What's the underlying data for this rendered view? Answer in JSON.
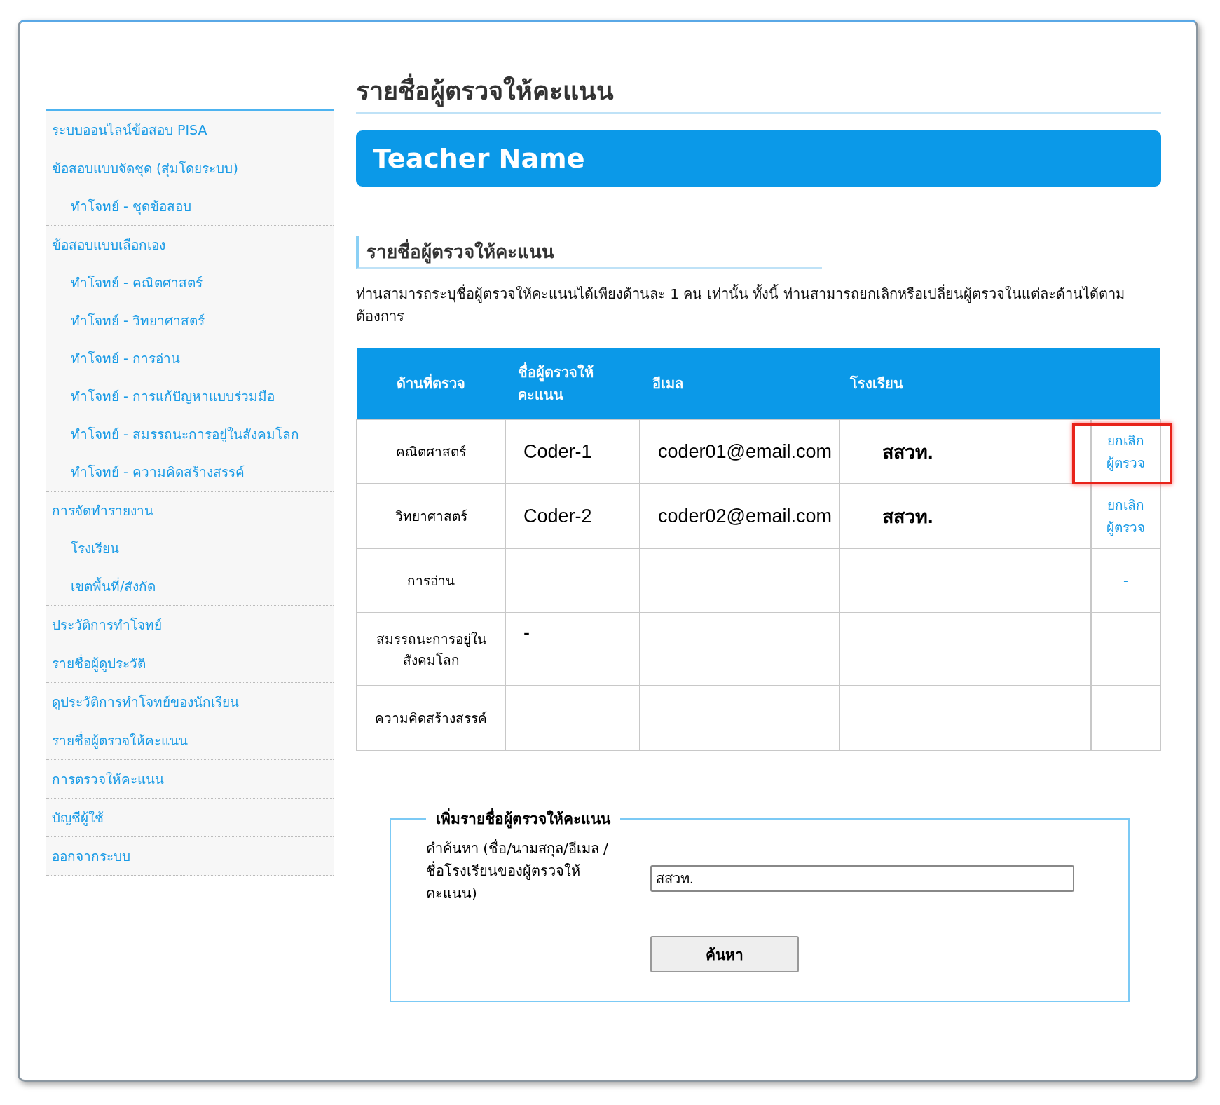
{
  "sidebar": {
    "items": [
      {
        "label": "ระบบออนไลน์ข้อสอบ PISA"
      },
      {
        "label": "ข้อสอบแบบจัดชุด (สุ่มโดยระบบ)",
        "children": [
          {
            "label": "ทำโจทย์ - ชุดข้อสอบ"
          }
        ]
      },
      {
        "label": "ข้อสอบแบบเลือกเอง",
        "children": [
          {
            "label": "ทำโจทย์ - คณิตศาสตร์"
          },
          {
            "label": "ทำโจทย์ - วิทยาศาสตร์"
          },
          {
            "label": "ทำโจทย์ - การอ่าน"
          },
          {
            "label": "ทำโจทย์ - การแก้ปัญหาแบบร่วมมือ"
          },
          {
            "label": "ทำโจทย์ - สมรรถนะการอยู่ในสังคมโลก"
          },
          {
            "label": "ทำโจทย์ - ความคิดสร้างสรรค์"
          }
        ]
      },
      {
        "label": "การจัดทำรายงาน",
        "children": [
          {
            "label": "โรงเรียน"
          },
          {
            "label": "เขตพื้นที่/สังกัด"
          }
        ]
      },
      {
        "label": "ประวัติการทำโจทย์"
      },
      {
        "label": "รายชื่อผู้ดูประวัติ"
      },
      {
        "label": "ดูประวัติการทำโจทย์ของนักเรียน"
      },
      {
        "label": "รายชื่อผู้ตรวจให้คะแนน"
      },
      {
        "label": "การตรวจให้คะแนน"
      },
      {
        "label": "บัญชีผู้ใช้"
      },
      {
        "label": "ออกจากระบบ"
      }
    ]
  },
  "page_title": "รายชื่อผู้ตรวจให้คะแนน",
  "banner": "Teacher Name",
  "section_title": "รายชื่อผู้ตรวจให้คะแนน",
  "description": "ท่านสามารถระบุชื่อผู้ตรวจให้คะแนนได้เพียงด้านละ 1 คน เท่านั้น ทั้งนี้ ท่านสามารถยกเลิกหรือเปลี่ยนผู้ตรวจในแต่ละด้านได้ตามต้องการ",
  "table": {
    "columns": [
      "ด้านที่ตรวจ",
      "ชื่อผู้ตรวจให้คะแนน",
      "อีเมล",
      "โรงเรียน"
    ],
    "rows": [
      {
        "domain": "คณิตศาสตร์",
        "coder": "Coder-1",
        "email": "coder01@email.com",
        "school": "สสวท.",
        "action": "ยกเลิกผู้ตรวจ",
        "highlighted": true
      },
      {
        "domain": "วิทยาศาสตร์",
        "coder": "Coder-2",
        "email": "coder02@email.com",
        "school": "สสวท.",
        "action": "ยกเลิกผู้ตรวจ",
        "highlighted": false
      },
      {
        "domain": "การอ่าน",
        "action": "-",
        "highlighted": false
      },
      {
        "domain": "สมรรถนะการอยู่ในสังคมโลก",
        "coder": "-",
        "highlighted": false
      },
      {
        "domain": "ความคิดสร้างสรรค์",
        "highlighted": false
      }
    ]
  },
  "add_form": {
    "legend": "เพิ่มรายชื่อผู้ตรวจให้คะแนน",
    "label": "คำค้นหา (ชื่อ/นามสกุล/อีเมล /ชื่อโรงเรียนของผู้ตรวจให้คะแนน)",
    "value": "สสวท.",
    "button": "ค้นหา"
  }
}
